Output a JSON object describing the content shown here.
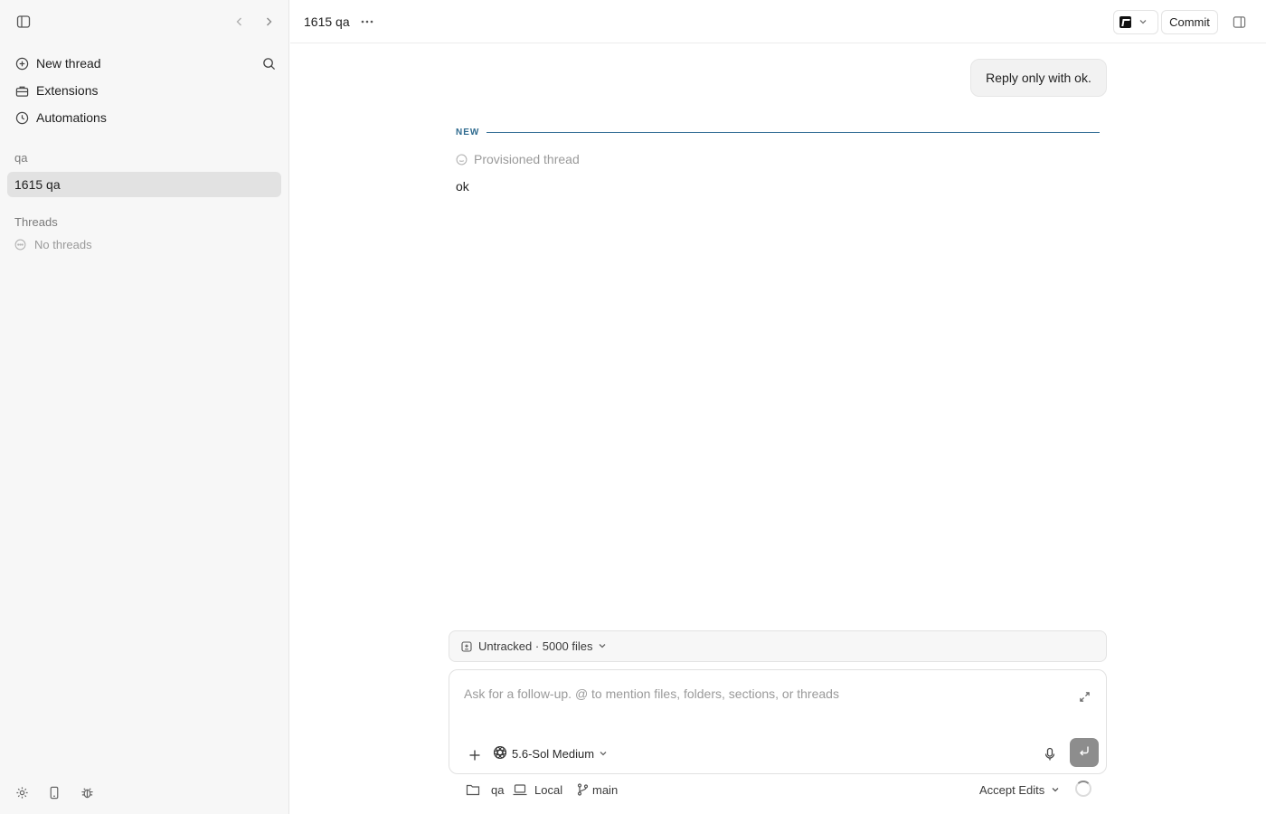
{
  "sidebar": {
    "nav": [
      {
        "label": "New thread",
        "icon": "plus-circle-icon"
      },
      {
        "label": "Extensions",
        "icon": "toolbox-icon"
      },
      {
        "label": "Automations",
        "icon": "clock-icon"
      }
    ],
    "project_section": "qa",
    "project_item": "1615 qa",
    "threads_section": "Threads",
    "no_threads": "No threads",
    "bottom_icons": [
      "settings-icon",
      "phone-icon",
      "bug-icon"
    ]
  },
  "header": {
    "title": "1615 qa",
    "commit_label": "Commit"
  },
  "conversation": {
    "user_message": "Reply only with ok.",
    "new_divider_label": "NEW",
    "provisioned_label": "Provisioned thread",
    "assistant_reply": "ok"
  },
  "composer": {
    "untracked_label": "Untracked · 5000 files",
    "placeholder": "Ask for a follow-up. @ to mention files, folders, sections, or threads",
    "value": "",
    "model_label": "5.6-Sol Medium"
  },
  "footer": {
    "folder": "qa",
    "env": "Local",
    "branch": "main",
    "mode": "Accept Edits"
  },
  "colors": {
    "sidebar_bg": "#f7f7f7",
    "selected_bg": "#e2e2e2",
    "divider_accent": "#3a7399",
    "send_button": "#8d8d8d"
  }
}
